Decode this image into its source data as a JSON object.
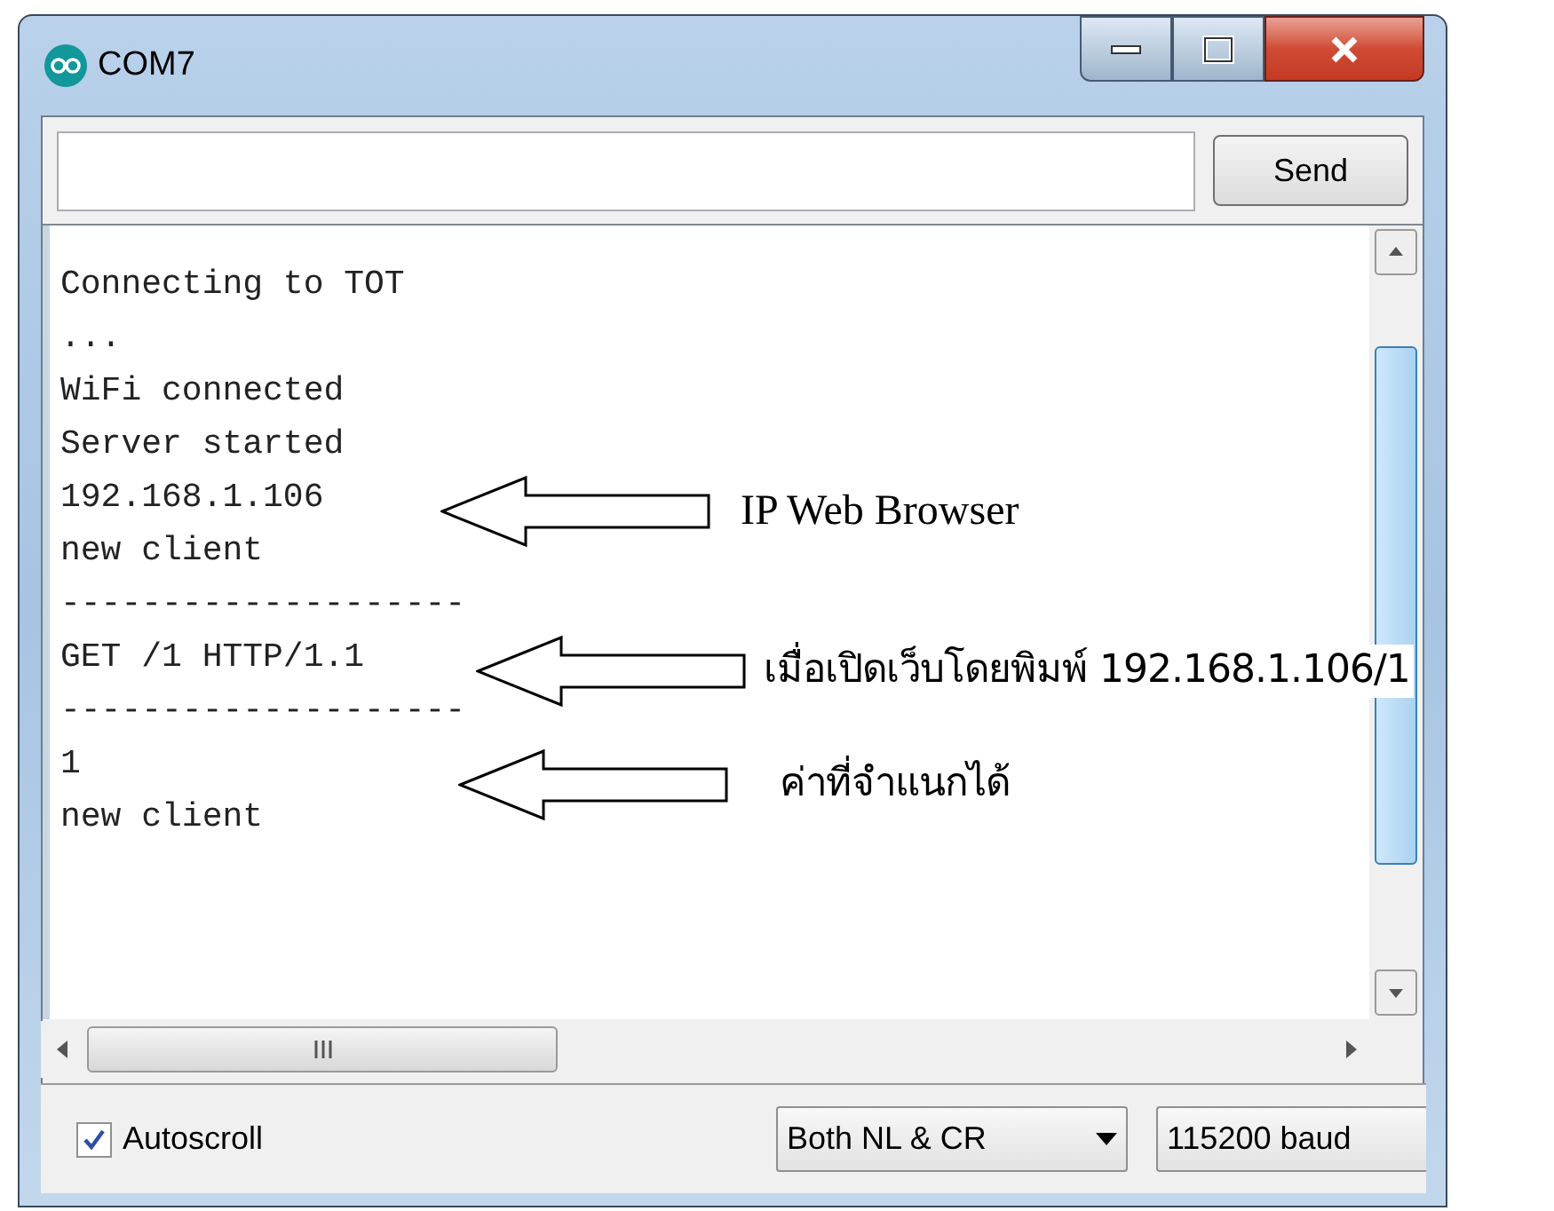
{
  "window": {
    "title": "COM7"
  },
  "send_button": "Send",
  "output_lines": [
    "Connecting to TOT",
    "...",
    "WiFi connected",
    "Server started",
    "192.168.1.106",
    "new client",
    "--------------------",
    "GET /1 HTTP/1.1",
    "--------------------",
    "1",
    "new client"
  ],
  "annotations": [
    {
      "text": "IP Web Browser",
      "kind": "serif"
    },
    {
      "text": "เมื่อเปิดเว็บโดยพิมพ์ 192.168.1.106/1",
      "kind": "sans"
    },
    {
      "text": "ค่าที่จำแนกได้",
      "kind": "sans"
    }
  ],
  "autoscroll": {
    "label": "Autoscroll",
    "checked": true
  },
  "line_ending": "Both NL & CR",
  "baud": "115200 baud"
}
